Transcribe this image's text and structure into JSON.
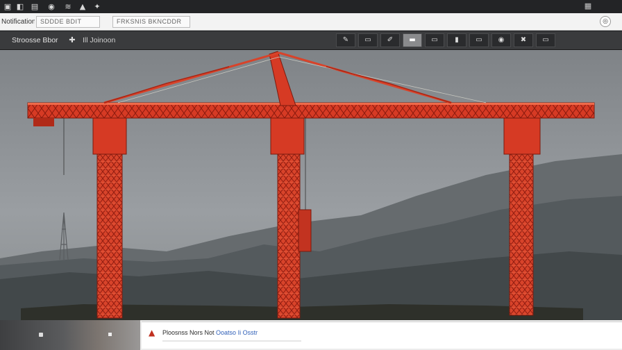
{
  "system_bar": {
    "icons": [
      "window-icon",
      "grid-icon",
      "image-icon",
      "info-icon",
      "wifi-icon",
      "text-icon",
      "star-icon"
    ],
    "glyphs": [
      "▣",
      "◧",
      "▤",
      "◉",
      "≋",
      "▲",
      "✦"
    ],
    "right_glyph": "▦"
  },
  "address_bar": {
    "title": "Notification",
    "field_one": "SDDDE BDIT",
    "field_two": "FRKSNIS BKNCDDR",
    "end_glyph": "◎"
  },
  "toolbar": {
    "title": "Stroosse Bbor",
    "icon_glyph": "✚",
    "subtitle": "Ill Joinoon",
    "buttons": [
      {
        "glyph": "✎",
        "active": false
      },
      {
        "glyph": "▭",
        "active": false
      },
      {
        "glyph": "✐",
        "active": false
      },
      {
        "glyph": "▬",
        "active": true
      },
      {
        "glyph": "▭",
        "active": false
      },
      {
        "glyph": "▮",
        "active": false
      },
      {
        "glyph": "▭",
        "active": false
      },
      {
        "glyph": "◉",
        "active": false
      },
      {
        "glyph": "✖",
        "active": false
      },
      {
        "glyph": "▭",
        "active": false
      }
    ]
  },
  "bottom_bar": {
    "caption_prefix": "Ploosnss Nors Not",
    "caption_link": "Ooatso Ii Osstr",
    "caption_icon": "▲"
  },
  "colors": {
    "crane_red": "#d63a24",
    "crane_dark": "#a82214",
    "sky": "#8d9195",
    "hills": "#4f5456"
  }
}
